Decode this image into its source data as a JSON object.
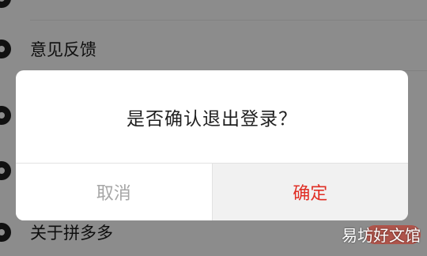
{
  "settings": {
    "items": [
      {
        "label": "意见反馈",
        "icon": "feedback-icon"
      },
      {
        "label": "",
        "icon": "info-icon"
      },
      {
        "label": "",
        "icon": "settings-icon"
      },
      {
        "label": "关于拼多多",
        "icon": "about-icon"
      }
    ]
  },
  "dialog": {
    "message": "是否确认退出登录？",
    "cancel_label": "取消",
    "confirm_label": "确定"
  },
  "watermark": {
    "text": "易坊好文馆"
  },
  "colors": {
    "confirm": "#e02e24",
    "cancel": "#a6a6a6",
    "overlay": "rgba(0,0,0,0.45)"
  }
}
